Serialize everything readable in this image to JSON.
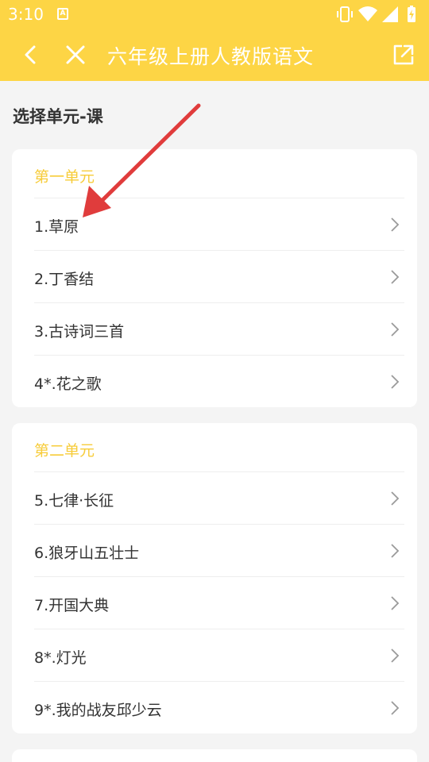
{
  "status_bar": {
    "time": "3:10",
    "notification_icon_letter": "A",
    "icons": [
      "vibrate-icon",
      "wifi-icon",
      "signal-icon",
      "battery-icon"
    ]
  },
  "toolbar": {
    "title": "六年级上册人教版语文",
    "back_icon": "chevron-left-icon",
    "close_icon": "close-icon",
    "share_icon": "share-icon"
  },
  "page": {
    "section_title": "选择单元-课"
  },
  "colors": {
    "header_bg": "#fdd545",
    "unit_title": "#f7cc3a",
    "annotation_arrow": "#e03c3c"
  },
  "units": [
    {
      "title": "第一单元",
      "lessons": [
        "1.草原",
        "2.丁香结",
        "3.古诗词三首",
        "4*.花之歌"
      ]
    },
    {
      "title": "第二单元",
      "lessons": [
        "5.七律·长征",
        "6.狼牙山五壮士",
        "7.开国大典",
        "8*.灯光",
        "9*.我的战友邱少云"
      ]
    }
  ]
}
